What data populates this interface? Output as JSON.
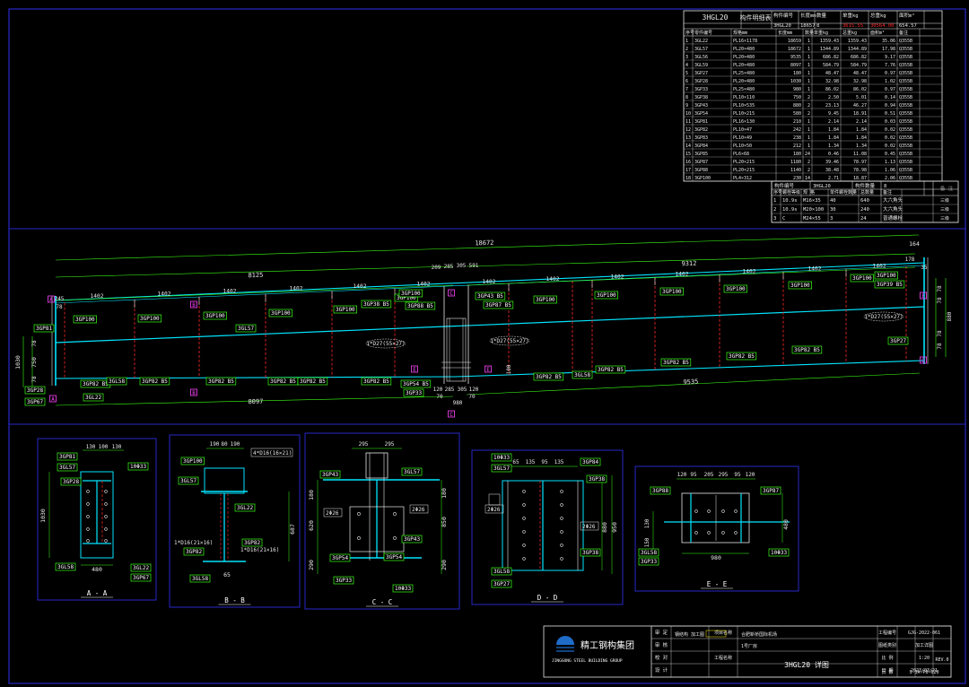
{
  "frame_color": "#2828c8",
  "line_color": "#00e5ff",
  "dim_color": "#39ff14",
  "mark_color": "#ff2a2a",
  "bom": {
    "title_cell": "3HGL20",
    "head_label": "构件明细表",
    "head_cols": [
      "构件编号",
      "长度mm",
      "数量",
      "单重kg",
      "总重kg",
      "面积m²"
    ],
    "head_vals": [
      "3HGL20",
      "18657",
      "8",
      "3615.55",
      "30564.00",
      "654.57"
    ],
    "cols": [
      "序号",
      "零件编号",
      "规格mm",
      "长度mm",
      "数量",
      "单重kg",
      "总重kg",
      "面积m²",
      "备注"
    ],
    "rows": [
      [
        "1",
        "3GL22",
        "PL16×1178",
        "18659",
        "1",
        "1359.43",
        "1359.43",
        "35.06",
        "Q355B"
      ],
      [
        "2",
        "3GL57",
        "PL20×480",
        "18672",
        "1",
        "1344.89",
        "1344.89",
        "17.98",
        "Q355B"
      ],
      [
        "3",
        "3GL56",
        "PL20×480",
        "9535",
        "1",
        "686.82",
        "686.82",
        "9.17",
        "Q355B"
      ],
      [
        "4",
        "3GL59",
        "PL20×480",
        "8097",
        "1",
        "584.79",
        "584.79",
        "7.76",
        "Q355B"
      ],
      [
        "5",
        "3GP27",
        "PL25×480",
        "180",
        "1",
        "48.47",
        "48.47",
        "0.97",
        "Q355B"
      ],
      [
        "6",
        "3GP28",
        "PL20×480",
        "1030",
        "1",
        "32.98",
        "32.98",
        "1.02",
        "Q355B"
      ],
      [
        "7",
        "3GP33",
        "PL25×480",
        "980",
        "1",
        "86.02",
        "86.02",
        "0.97",
        "Q355B"
      ],
      [
        "8",
        "3GP38",
        "PL10×110",
        "750",
        "2",
        "2.50",
        "5.01",
        "0.14",
        "Q355B"
      ],
      [
        "9",
        "3GP43",
        "PL10×535",
        "880",
        "2",
        "23.13",
        "46.27",
        "0.94",
        "Q355B"
      ],
      [
        "10",
        "3GP54",
        "PL10×215",
        "580",
        "2",
        "9.45",
        "18.91",
        "0.51",
        "Q355B"
      ],
      [
        "11",
        "3GP81",
        "PL16×130",
        "210",
        "1",
        "2.14",
        "2.14",
        "0.03",
        "Q355B"
      ],
      [
        "12",
        "3GP82",
        "PL10×47",
        "242",
        "1",
        "1.84",
        "1.84",
        "0.02",
        "Q355B"
      ],
      [
        "13",
        "3GP83",
        "PL10×49",
        "238",
        "1",
        "1.84",
        "1.84",
        "0.02",
        "Q355B"
      ],
      [
        "14",
        "3GP84",
        "PL10×50",
        "212",
        "1",
        "1.34",
        "1.34",
        "0.02",
        "Q355B"
      ],
      [
        "15",
        "3GP85",
        "PL6×68",
        "180",
        "24",
        "0.46",
        "11.08",
        "0.45",
        "Q355B"
      ],
      [
        "16",
        "3GP87",
        "PL20×215",
        "1180",
        "2",
        "39.46",
        "78.97",
        "1.13",
        "Q355B"
      ],
      [
        "17",
        "3GP88",
        "PL20×215",
        "1140",
        "2",
        "38.48",
        "78.98",
        "1.06",
        "Q355B"
      ],
      [
        "18",
        "3GP100",
        "PL4×312",
        "230",
        "14",
        "2.71",
        "18.87",
        "2.06",
        "Q355B"
      ]
    ]
  },
  "bolts": {
    "title": "3HGL20",
    "head_cols": [
      "构件编号",
      "",
      "构件数量",
      "8"
    ],
    "note": "备 注",
    "cols": [
      "序号",
      "螺栓等级",
      "规 格",
      "单件螺栓数量",
      "总数量",
      "备注"
    ],
    "rows": [
      [
        "1",
        "10.9s",
        "M16×35",
        "40",
        "640",
        "大六角头"
      ],
      [
        "2",
        "10.9s",
        "M20×100",
        "30",
        "240",
        "大六角头"
      ],
      [
        "3",
        "C",
        "M24×55",
        "3",
        "24",
        "普通螺栓"
      ]
    ],
    "side": [
      "三级",
      "三级",
      "三级"
    ]
  },
  "elevation": {
    "overall_top": "18672",
    "right_top": "164",
    "seg_left": "8125",
    "seg_right": "9312",
    "mid_dims": [
      "209",
      "285",
      "305",
      "591"
    ],
    "spacing": "1402",
    "right_small": [
      "178",
      "35"
    ],
    "left_small": [
      "245",
      "78"
    ],
    "left_heights": [
      "1030",
      "750",
      "78"
    ],
    "right_heights": [
      "78",
      "78",
      "880",
      "78",
      "78"
    ],
    "bottom_left": "8097",
    "bottom_right": "9535",
    "bottom_mid": [
      "120",
      "285",
      "305",
      "120",
      "70",
      "70",
      "980"
    ],
    "right_bottom": "100",
    "hole_left": "1*D27(55×27)",
    "hole_mid": "1*D27(55×27)",
    "hole_right": "1*D27(55×27)",
    "section_marks": [
      "A",
      "B",
      "C",
      "D",
      "E"
    ],
    "tags_top": [
      "3GP100",
      "3GP100",
      "3GP100",
      "3GL57",
      "3GP100",
      "3GP100",
      "3GP100",
      "3GP100",
      "3GP100",
      "3GP100",
      "3GP100",
      "3GP100",
      "3GP100"
    ],
    "tags_mid": [
      "3GP43 B5",
      "3GP88 B5",
      "3GP87 B5",
      "3GP38 B5",
      "3GP100",
      "3GP39 B5"
    ],
    "tags_bottom": [
      "3GP82 B5",
      "3GL58",
      "3GP82 B5",
      "3GP82 B5",
      "3GP82 B5",
      "3GP82 B5",
      "3GP82 B5",
      "3GP54 B5",
      "3GP33",
      "3GP82 B5",
      "3GL58",
      "3GP82 B5",
      "3GP82 B5",
      "3GP82 B5",
      "3GP82 B5",
      "3GP27"
    ],
    "tags_left": [
      "3GP81",
      "3GP28",
      "3GP67",
      "3GL22",
      "3GP100"
    ]
  },
  "sections": [
    {
      "title": "A - A",
      "dims": [
        "130",
        "100",
        "130",
        "1030",
        "480"
      ],
      "tags": [
        "3GP81",
        "3GL57",
        "3GP28",
        "10Φ33",
        "3GL58",
        "3GL22",
        "3GP67"
      ]
    },
    {
      "title": "B - B",
      "dims": [
        "190",
        "80",
        "190",
        "687",
        "65"
      ],
      "tags": [
        "3GP100",
        "3GL57",
        "3GL22",
        "3GP82",
        "3GP82",
        "3GL58"
      ],
      "notes": [
        "4*D16(16×21)",
        "1*D16(21×16)",
        "1*D16(21×16)"
      ]
    },
    {
      "title": "C - C",
      "dims": [
        "295",
        "295",
        "180",
        "300",
        "620",
        "850",
        "290"
      ],
      "tags": [
        "3GP43",
        "3GL57",
        "3GP54",
        "3GP54",
        "3GP43",
        "3GP33",
        "10Φ33"
      ],
      "notes": [
        "2Φ26",
        "2Φ26"
      ]
    },
    {
      "title": "D - D",
      "dims": [
        "65",
        "135",
        "95",
        "135",
        "880",
        "950"
      ],
      "tags": [
        "10Φ33",
        "3GL57",
        "3GP84",
        "3GP38",
        "3GP38",
        "3GL58",
        "3GP27"
      ],
      "notes": [
        "2Φ26",
        "2Φ26"
      ]
    },
    {
      "title": "E - E",
      "dims": [
        "120",
        "95",
        "205",
        "295",
        "95",
        "120",
        "980",
        "480",
        "130",
        "150"
      ],
      "tags": [
        "3GP88",
        "3GP87",
        "3GL58",
        "3GP33",
        "10Φ33"
      ]
    }
  ],
  "title_block": {
    "company_cn": "精工钢构集团",
    "company_en": "JINGGONG STEEL BUILDING GROUP",
    "rows": [
      [
        "审 定",
        "",
        "项目名称",
        "",
        "工程编号",
        "GJG-2022-061"
      ],
      [
        "审 核",
        "",
        "",
        "",
        "图纸类别",
        "加工详图"
      ],
      [
        "校 对",
        "",
        "工程名称",
        "",
        "比 例",
        "1:20"
      ],
      [
        "设 计",
        "",
        "",
        "",
        "日 期",
        "2023/03/21"
      ]
    ],
    "sign_text": "钢结构 加工图",
    "project_text": "合肥新桥国际机场",
    "proj_name": "1号厂房",
    "drawing_title": "3HGL20 详图",
    "drawing_no": "S-3A-PB-020",
    "rev": "REV.0",
    "sheet_no": "页 数"
  }
}
